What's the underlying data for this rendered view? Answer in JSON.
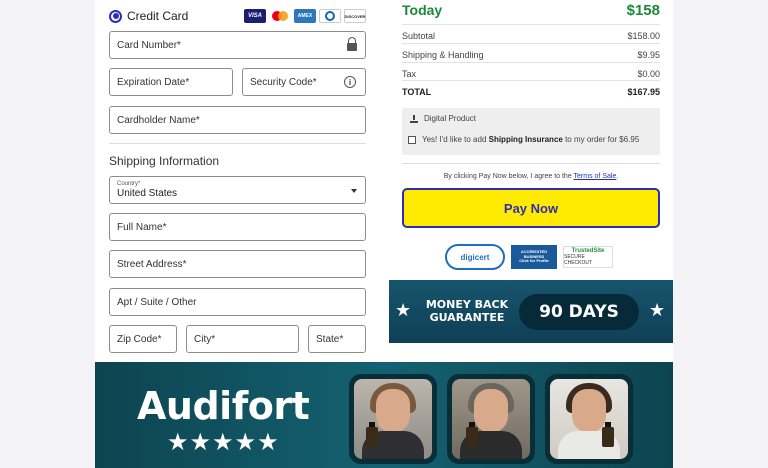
{
  "payment": {
    "method_label": "Credit Card",
    "card_brands": [
      "VISA",
      "mastercard",
      "AMEX",
      "diners",
      "DISCOVER"
    ],
    "card_number_label": "Card Number*",
    "expiration_label": "Expiration Date*",
    "security_code_label": "Security Code*",
    "cardholder_label": "Cardholder Name*"
  },
  "shipping": {
    "title": "Shipping Information",
    "country_small_label": "Country*",
    "country_value": "United States",
    "full_name_label": "Full Name*",
    "street_label": "Street Address*",
    "apt_label": "Apt / Suite / Other",
    "zip_label": "Zip Code*",
    "city_label": "City*",
    "state_label": "State*"
  },
  "summary": {
    "today_label": "Today",
    "today_value": "$158",
    "rows": [
      {
        "label": "Subtotal",
        "value": "$158.00"
      },
      {
        "label": "Shipping & Handling",
        "value": "$9.95"
      },
      {
        "label": "Tax",
        "value": "$0.00"
      },
      {
        "label": "TOTAL",
        "value": "$167.95"
      }
    ],
    "digital_product": "Digital Product",
    "insurance_prefix": "Yes! I'd like to add ",
    "insurance_bold": "Shipping Insurance",
    "insurance_suffix": " to my order for $6.95"
  },
  "checkout": {
    "terms_prefix": "By clicking Pay Now below, I agree to the ",
    "terms_link": "Terms of Sale",
    "terms_suffix": ".",
    "pay_button": "Pay Now"
  },
  "badges": {
    "digicert": "digicert",
    "bbb_line1": "ACCREDITED",
    "bbb_line2": "BUSINESS",
    "bbb_line3": "Click for Profile",
    "trusted_top": "TrustedSite",
    "trusted_bottom": "SECURE CHECKOUT"
  },
  "guarantee": {
    "line1": "MONEY BACK",
    "line2": "GUARANTEE",
    "days": "90 DAYS"
  },
  "banner": {
    "brand": "Audifort",
    "stars": "★★★★★"
  },
  "icons": {
    "lock": "lock-icon",
    "info": "info-icon",
    "download": "download-icon",
    "caret": "chevron-down-icon"
  },
  "colors": {
    "accent": "#2d2db8",
    "today_green": "#1a8a3a",
    "pay_button_bg": "#ffea00",
    "banner_bg": "#146171"
  }
}
